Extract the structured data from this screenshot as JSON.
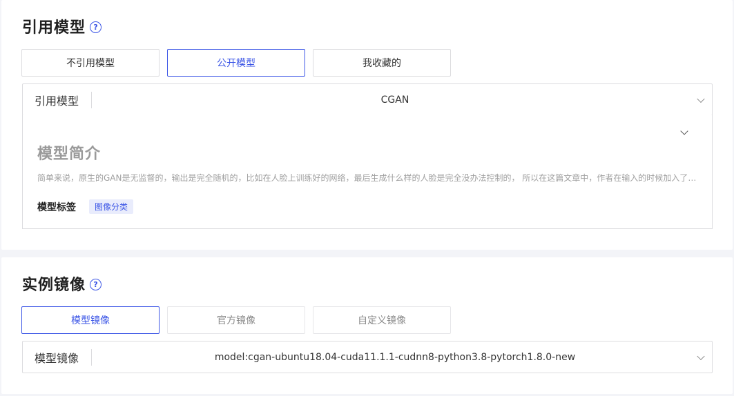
{
  "model_section": {
    "title": "引用模型",
    "tabs": [
      {
        "label": "不引用模型",
        "state": "normal"
      },
      {
        "label": "公开模型",
        "state": "active"
      },
      {
        "label": "我收藏的",
        "state": "normal"
      }
    ],
    "select": {
      "label": "引用模型",
      "value": "CGAN"
    },
    "intro": {
      "title": "模型简介",
      "description": "简单来说，原生的GAN是无监督的，输出是完全随机的，比如在人脸上训练好的网络，最后生成什么样的人脸是完全没办法控制的， 所以在这篇文章中，作者在输入的时候加入了条件（类别图片），使得生成的图片是受控的，可以生成指定类别的图片。",
      "tags_label": "模型标签",
      "tags": [
        "图像分类"
      ]
    }
  },
  "image_section": {
    "title": "实例镜像",
    "tabs": [
      {
        "label": "模型镜像",
        "state": "active"
      },
      {
        "label": "官方镜像",
        "state": "disabled"
      },
      {
        "label": "自定义镜像",
        "state": "disabled"
      }
    ],
    "select": {
      "label": "模型镜像",
      "value": "model:cgan-ubuntu18.04-cuda11.1.1-cudnn8-python3.8-pytorch1.8.0-new"
    }
  },
  "help_icon_glyph": "?",
  "colors": {
    "accent": "#3b55e6",
    "tag_bg": "#e9ecfc",
    "border": "#dcdcdf",
    "page_bg": "#f3f4f8"
  }
}
